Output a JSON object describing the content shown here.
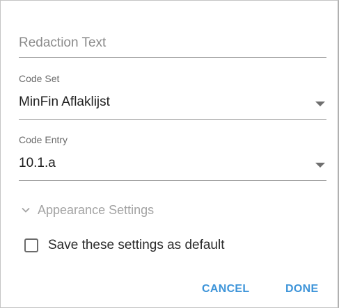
{
  "redaction_text": {
    "placeholder": "Redaction Text"
  },
  "code_set": {
    "label": "Code Set",
    "value": "MinFin Aflaklijst",
    "icon": "dropdown-arrow-icon"
  },
  "code_entry": {
    "label": "Code Entry",
    "value": "10.1.a",
    "icon": "dropdown-arrow-icon"
  },
  "appearance_settings": {
    "label": "Appearance Settings",
    "icon": "chevron-down-icon",
    "expanded": false
  },
  "save_default": {
    "label": "Save these settings as default",
    "checked": false
  },
  "actions": {
    "cancel_label": "CANCEL",
    "done_label": "DONE"
  },
  "colors": {
    "accent": "#3d94d9",
    "text": "#202020",
    "muted": "#a3a3a3",
    "divider": "#9a9a9a"
  }
}
